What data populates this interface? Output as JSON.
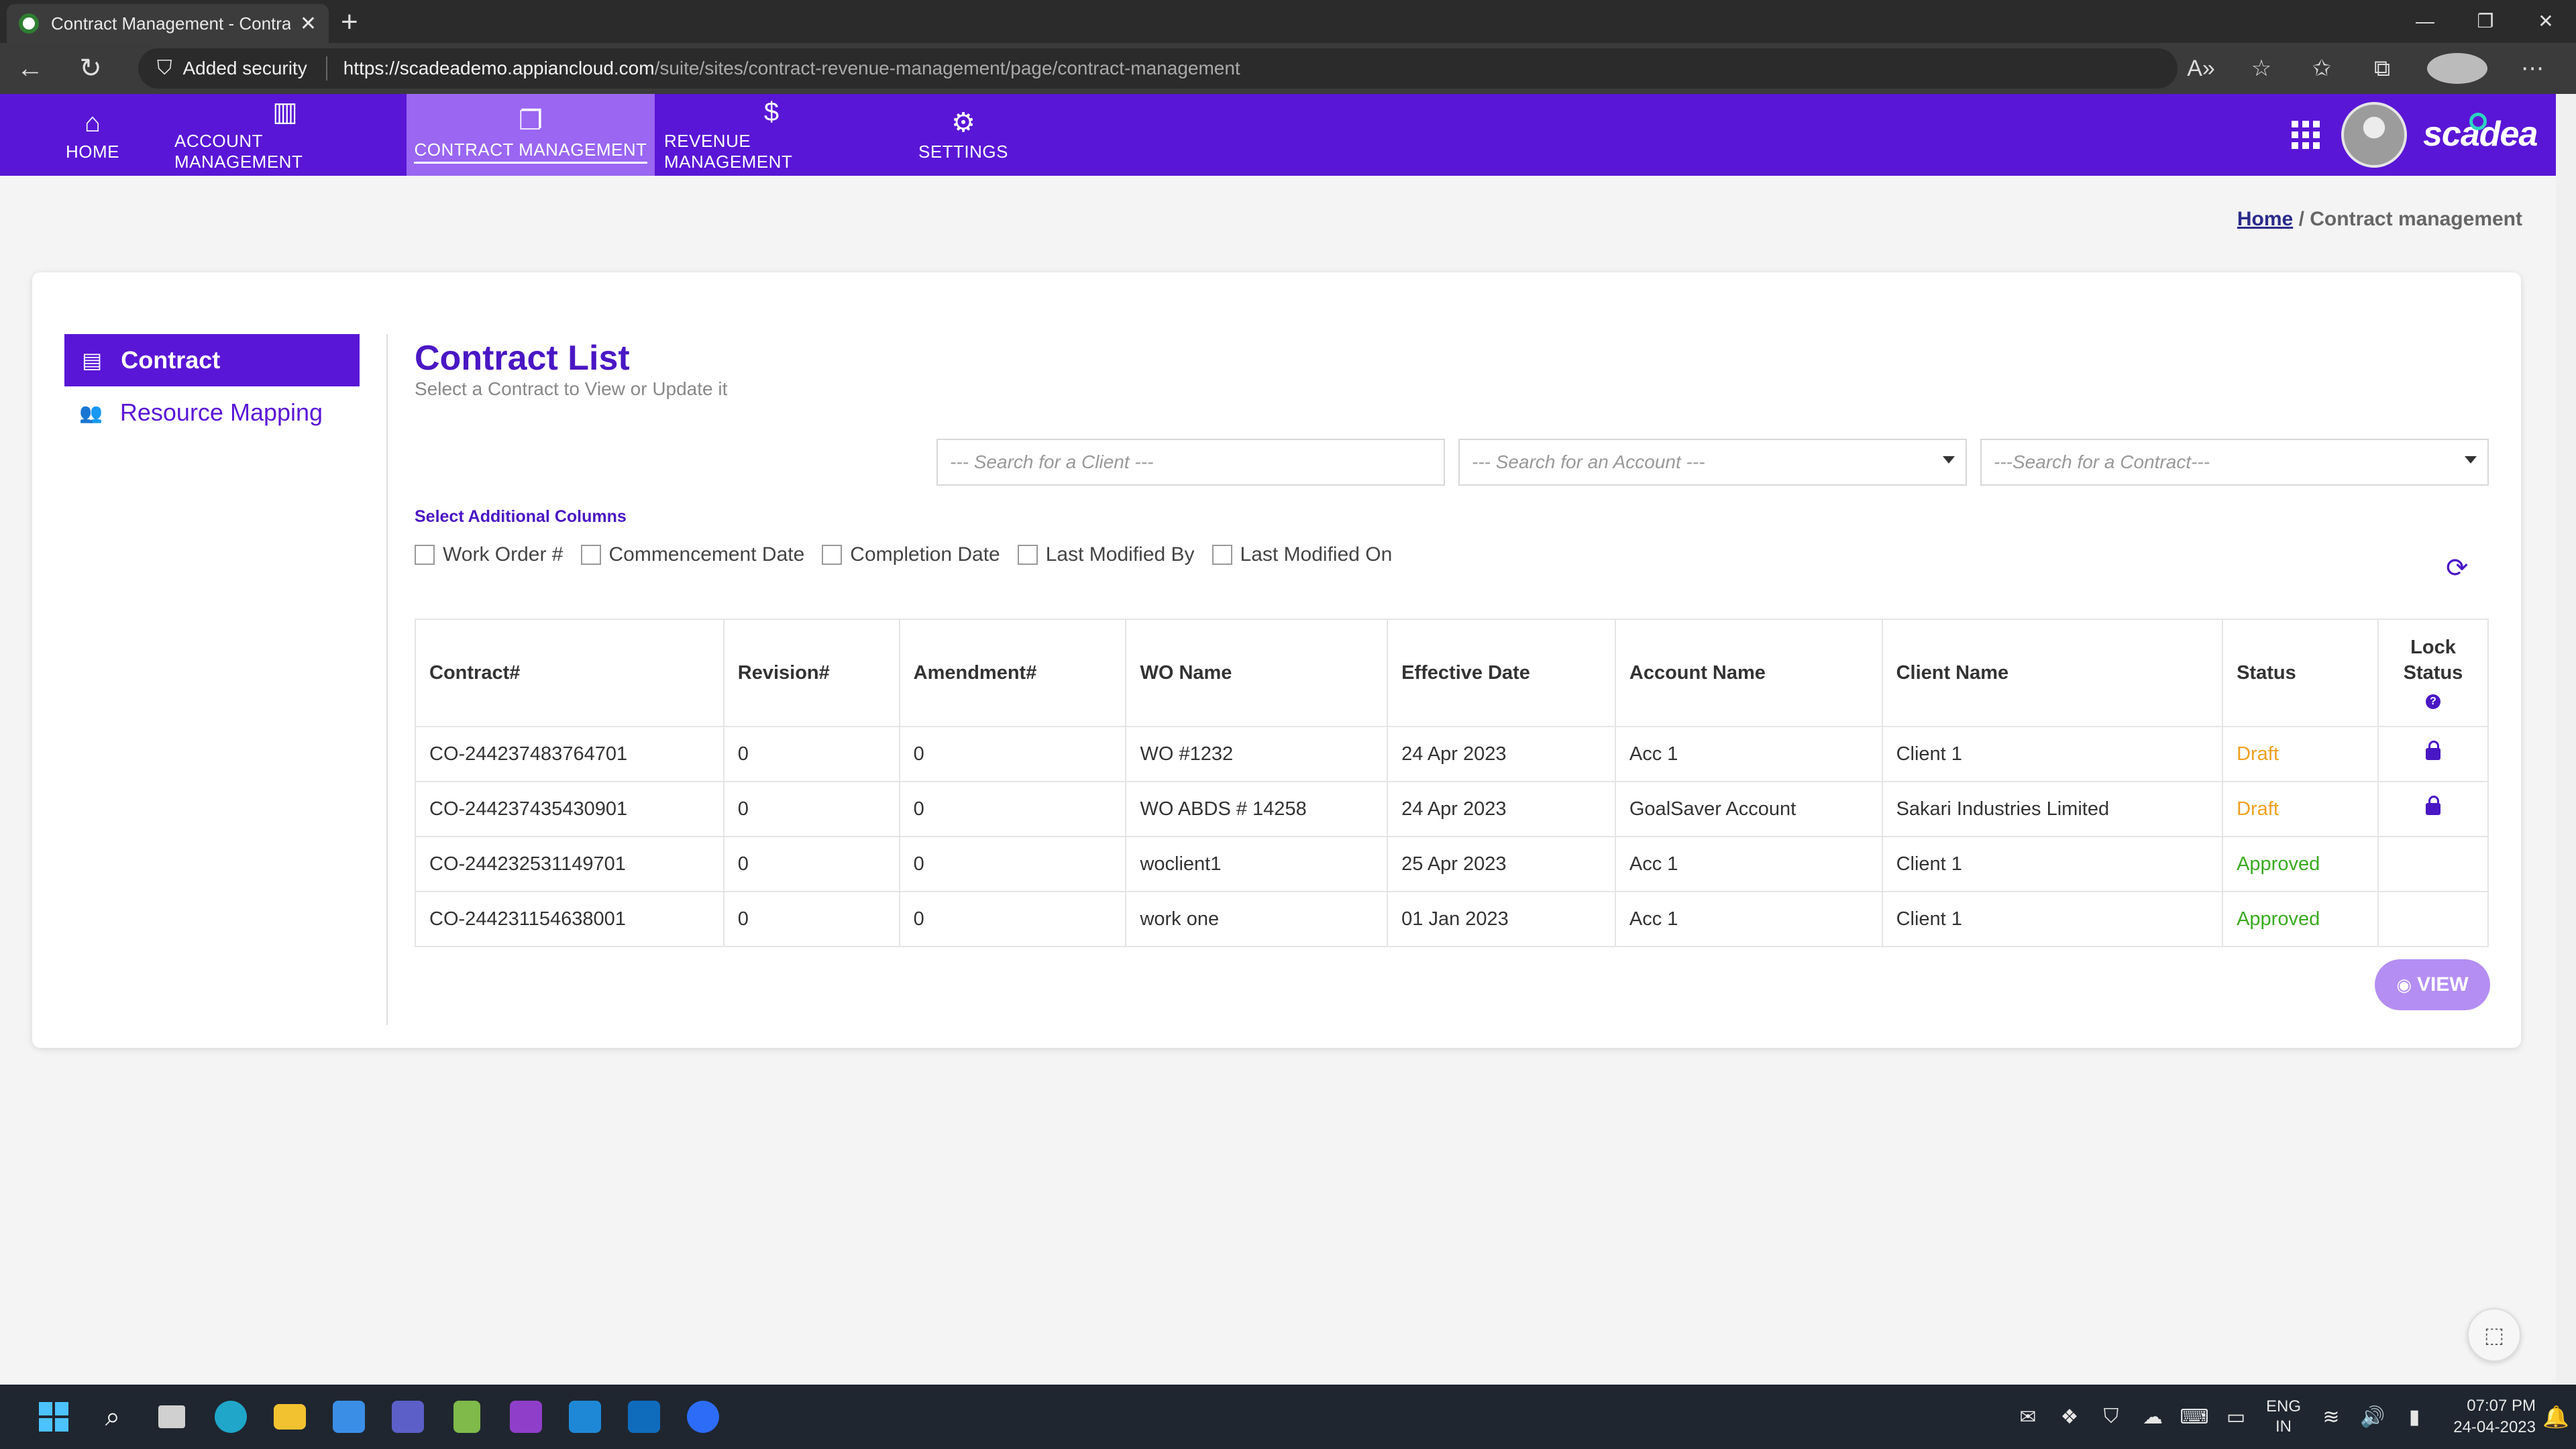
{
  "browser": {
    "tab_title": "Contract Management - Contrac",
    "security_label": "Added security",
    "url_host": "https://scadeademo.appiancloud.com",
    "url_path": "/suite/sites/contract-revenue-management/page/contract-management"
  },
  "nav": {
    "items": [
      {
        "label": "HOME",
        "icon": "home-icon"
      },
      {
        "label": "ACCOUNT MANAGEMENT",
        "icon": "building-icon"
      },
      {
        "label": "CONTRACT MANAGEMENT",
        "icon": "documents-icon",
        "active": true
      },
      {
        "label": "REVENUE MANAGEMENT",
        "icon": "dollar-icon"
      },
      {
        "label": "SETTINGS",
        "icon": "gear-icon"
      }
    ],
    "brand": "scadea"
  },
  "breadcrumb": {
    "home": "Home",
    "separator": " / ",
    "current": "Contract management"
  },
  "sidebar": {
    "items": [
      {
        "label": "Contract",
        "icon": "document-icon",
        "active": true
      },
      {
        "label": "Resource Mapping",
        "icon": "users-icon"
      }
    ]
  },
  "main": {
    "title": "Contract List",
    "subtitle": "Select a Contract to View or Update it",
    "search": {
      "client_placeholder": "--- Search for a Client ---",
      "account_placeholder": "--- Search for an Account ---",
      "contract_placeholder": "---Search for a Contract---"
    },
    "additional_columns_label": "Select Additional Columns",
    "additional_columns": [
      "Work Order #",
      "Commencement Date",
      "Completion Date",
      "Last Modified By",
      "Last Modified On"
    ],
    "table": {
      "headers": [
        "Contract#",
        "Revision#",
        "Amendment#",
        "WO Name",
        "Effective Date",
        "Account Name",
        "Client Name",
        "Status"
      ],
      "lock_header_line1": "Lock",
      "lock_header_line2": "Status",
      "help_glyph": "?",
      "rows": [
        {
          "contract": "CO-244237483764701",
          "revision": "0",
          "amendment": "0",
          "wo_name": "WO #1232",
          "effective_date": "24 Apr 2023",
          "account": "Acc 1",
          "client": "Client 1",
          "status": "Draft",
          "locked": true
        },
        {
          "contract": "CO-244237435430901",
          "revision": "0",
          "amendment": "0",
          "wo_name": "WO ABDS # 14258",
          "effective_date": "24 Apr 2023",
          "account": "GoalSaver Account",
          "client": "Sakari Industries Limited",
          "status": "Draft",
          "locked": true
        },
        {
          "contract": "CO-244232531149701",
          "revision": "0",
          "amendment": "0",
          "wo_name": "woclient1",
          "effective_date": "25 Apr 2023",
          "account": "Acc 1",
          "client": "Client 1",
          "status": "Approved",
          "locked": false
        },
        {
          "contract": "CO-244231154638001",
          "revision": "0",
          "amendment": "0",
          "wo_name": "work one",
          "effective_date": "01 Jan 2023",
          "account": "Acc 1",
          "client": "Client 1",
          "status": "Approved",
          "locked": false
        }
      ]
    },
    "view_button": "VIEW"
  },
  "taskbar": {
    "lang_line1": "ENG",
    "lang_line2": "IN",
    "time": "07:07 PM",
    "date": "24-04-2023"
  },
  "colors": {
    "brand_purple": "#5a16d6",
    "active_nav": "#9a66f2",
    "draft": "#f0a020",
    "approved": "#3aaa20"
  }
}
